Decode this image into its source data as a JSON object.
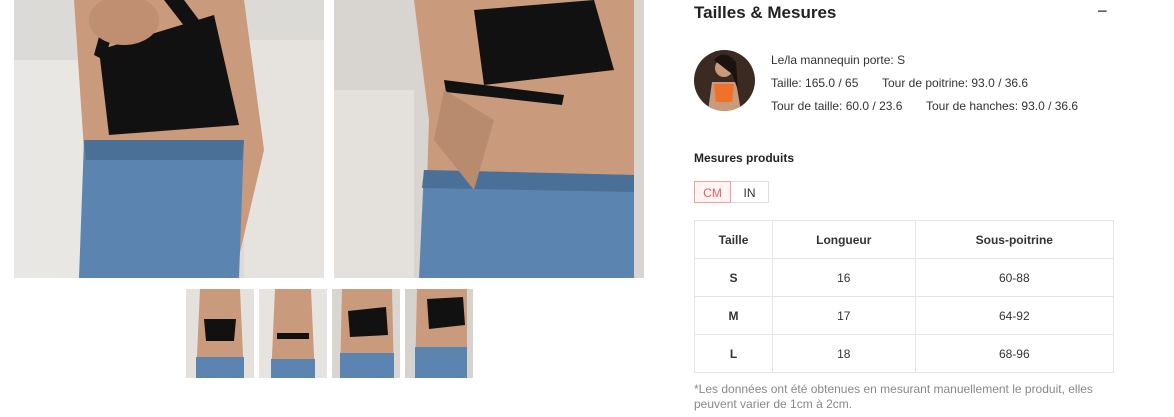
{
  "section": {
    "title": "Tailles & Mesures",
    "collapse_symbol": "−"
  },
  "model": {
    "wears_label": "Le/la mannequin porte: S",
    "height": "Taille: 165.0 / 65",
    "bust": "Tour de poitrine: 93.0 / 36.6",
    "waist": "Tour de taille: 60.0 / 23.6",
    "hips": "Tour de hanches: 93.0 / 36.6"
  },
  "measurements": {
    "title": "Mesures produits",
    "units": [
      "CM",
      "IN"
    ],
    "active_unit": "CM",
    "headers": [
      "Taille",
      "Longueur",
      "Sous-poitrine"
    ],
    "rows": [
      [
        "S",
        "16",
        "60-88"
      ],
      [
        "M",
        "17",
        "64-92"
      ],
      [
        "L",
        "18",
        "68-96"
      ]
    ]
  },
  "note": "*Les données ont été obtenues en mesurant manuellement le produit, elles peuvent varier de 1cm à 2cm.",
  "colors": {
    "accent": "#e06060",
    "accent_border": "#f0a0a0",
    "top": "#111111",
    "denim": "#5b84b1",
    "skin": "#c99a7c"
  }
}
